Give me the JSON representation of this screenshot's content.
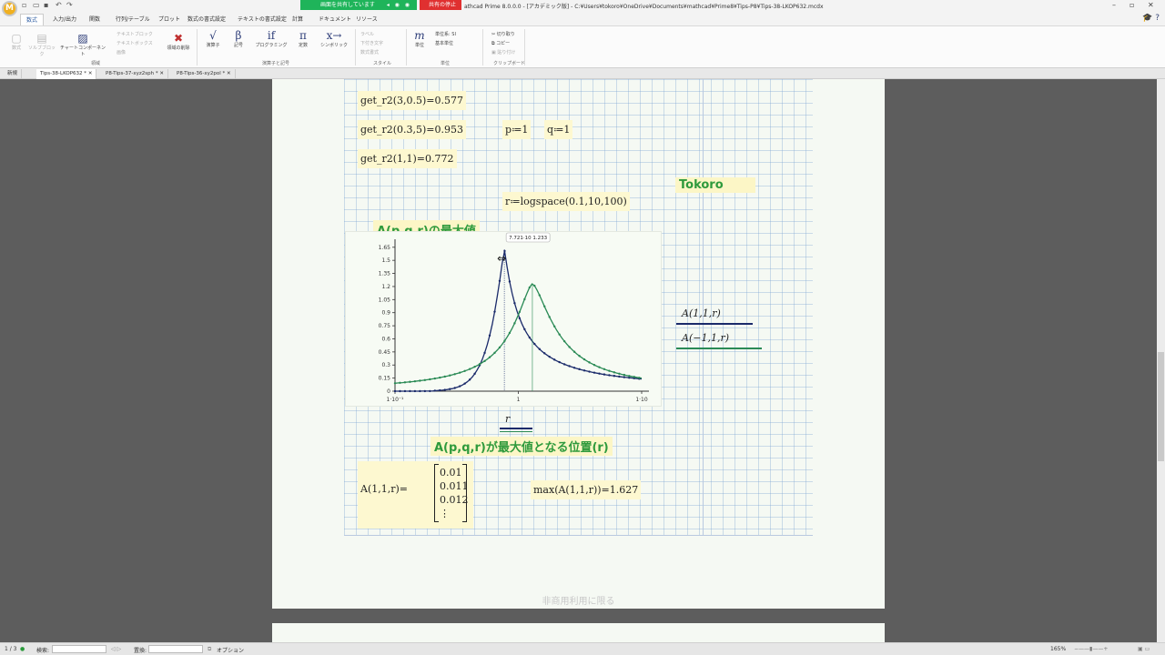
{
  "titlebar": {
    "share_status": "画面を共有しています",
    "stop_share": "共有の停止",
    "window_title": "athcad Prime 8.0.0.0 - [アカデミック版] - C:¥Users¥tokoro¥OneDrive¥Documents¥mathcad¥Prime8¥Tips-P8¥Tips-38-LKOP632.mcdx"
  },
  "menu": {
    "tabs": [
      "数式",
      "入力/出力",
      "関数",
      "行列/テーブル",
      "プロット",
      "数式の書式設定",
      "テキストの書式設定",
      "計算",
      "ドキュメント",
      "リソース"
    ]
  },
  "ribbon": {
    "math": "数式",
    "solve_block": "ソルブブロック",
    "chart_component": "チャートコンポーネント",
    "text_block": "テキストブロック",
    "text_box": "テキストボックス",
    "image": "画像",
    "region_delete": "領域の削除",
    "operators": "演算子",
    "symbols": "記号",
    "programming": "プログラミング",
    "constants": "定数",
    "symbolics": "シンボリック",
    "label": "ラベル",
    "subscript": "下付き文字",
    "math_format": "数式書式",
    "units": "単位",
    "unit_system": "単位系: SI",
    "base_unit": "基本単位",
    "cut": "切り取り",
    "copy": "コピー",
    "paste": "貼り付け",
    "group_regions": "領域",
    "group_operators": "演算子と記号",
    "group_style": "スタイル",
    "group_units": "単位",
    "group_clipboard": "クリップボード"
  },
  "doctabs": [
    {
      "label": "新規"
    },
    {
      "label": "Tips-38-LKOP632 *"
    },
    {
      "label": "P8-Tips-37-xyz2sph *"
    },
    {
      "label": "P8-Tips-36-xy2pol *"
    }
  ],
  "worksheet": {
    "eq1": "get_r2(3,0.5)=0.577",
    "eq2": "get_r2(0.3,5)=0.953",
    "eq3": "get_r2(1,1)=0.772",
    "p_def": "p≔1",
    "q_def": "q≔1",
    "r_def": "r≔logspace(0.1,10,100)",
    "author": "Tokoro",
    "heading_max": "A(p,q,r)の最大値",
    "heading_pos": "A(p,q,r)が最大値となる位置(r)",
    "a_result_label": "A(1,1,r)=",
    "a_vector": [
      "0.01",
      "0.011",
      "0.012",
      "⋮"
    ],
    "max_expr": "max(A(1,1,r))=1.627",
    "watermark": "非商用利用に限る"
  },
  "chart_data": {
    "type": "line",
    "y_ticks": [
      "0",
      "0.15",
      "0.3",
      "0.45",
      "0.6",
      "0.75",
      "0.9",
      "1.05",
      "1.2",
      "1.35",
      "1.5",
      "1.65"
    ],
    "x_ticks": [
      "1·10⁻¹",
      "1",
      "1·10"
    ],
    "x_label": "r",
    "ylim": [
      0,
      1.7
    ],
    "xlim": [
      0.1,
      10
    ],
    "x_scale": "log",
    "tooltip": "7.721·10",
    "tooltip2": "1.233",
    "series": [
      {
        "name": "A(1,1,r)",
        "color": "#1a2a6a",
        "peak_x": 0.77,
        "peak_y": 1.627
      },
      {
        "name": "A(−1,1,r)",
        "color": "#2a8a55",
        "peak_x": 1.3,
        "peak_y": 1.233
      }
    ]
  },
  "statusbar": {
    "page": "1 / 3",
    "search": "検索:",
    "replace": "置換:",
    "options": "オプション",
    "zoom": "165%"
  }
}
